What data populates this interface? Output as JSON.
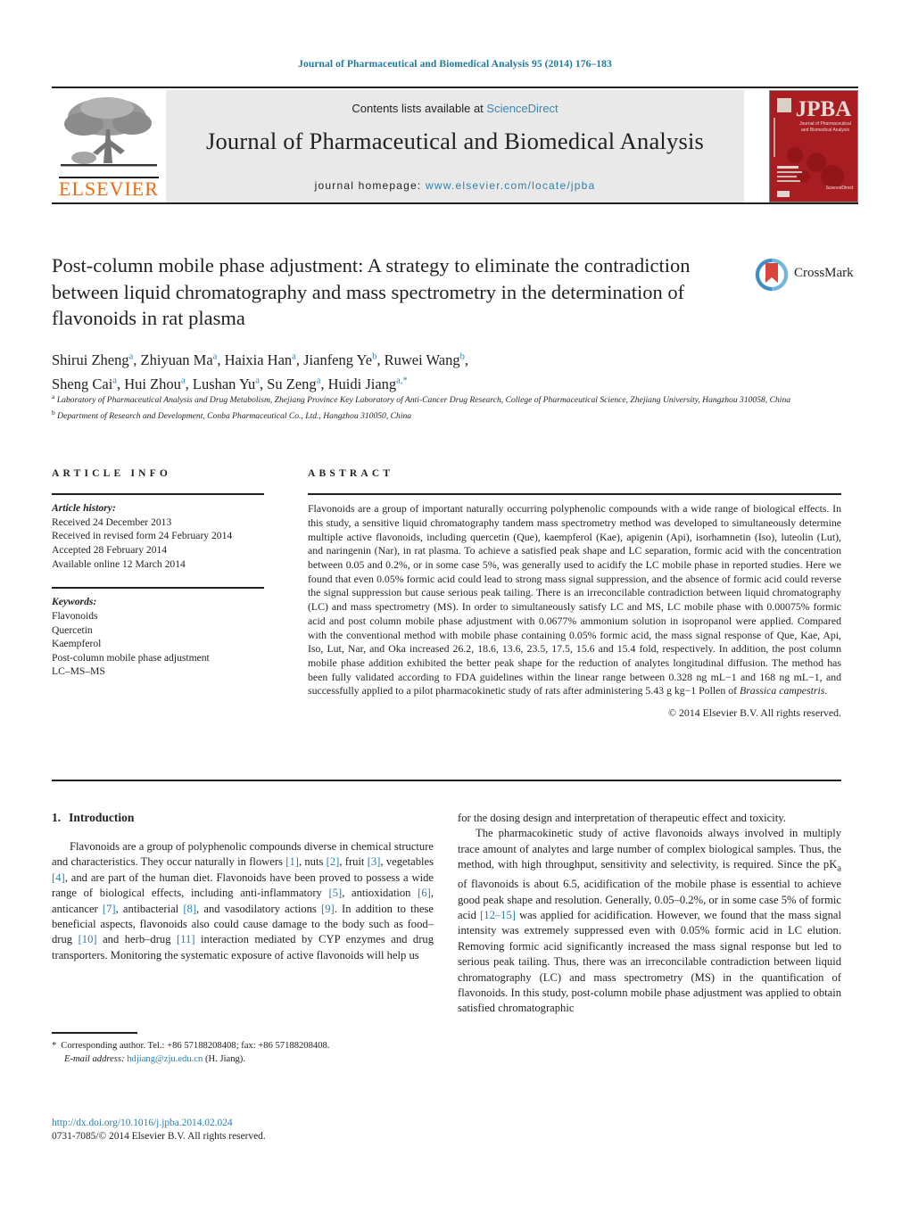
{
  "running_head": "Journal of Pharmaceutical and Biomedical Analysis 95 (2014) 176–183",
  "masthead": {
    "publisher": "ELSEVIER",
    "contents_prefix": "Contents lists available at ",
    "contents_link": "ScienceDirect",
    "journal_title": "Journal of Pharmaceutical and Biomedical Analysis",
    "homepage_label": "journal homepage:",
    "homepage_url": "www.elsevier.com/locate/jpba",
    "cover_title": "JPBA",
    "cover_subtitle": "Journal of Pharmaceutical and Biomedical Analysis",
    "cover_footer": "ScienceDirect"
  },
  "article": {
    "title": "Post-column mobile phase adjustment: A strategy to eliminate the contradiction between liquid chromatography and mass spectrometry in the determination of flavonoids in rat plasma",
    "crossmark_label": "CrossMark",
    "authors_line1": "Shirui Zheng a , Zhiyuan Ma a , Haixia Han a , Jianfeng Ye b , Ruwei Wang b ,",
    "authors_line2": "Sheng Cai a , Hui Zhou a , Lushan Yu a , Su Zeng a , Huidi Jiang a,*",
    "authors": [
      {
        "name": "Shirui Zheng",
        "sup": "a"
      },
      {
        "name": "Zhiyuan Ma",
        "sup": "a"
      },
      {
        "name": "Haixia Han",
        "sup": "a"
      },
      {
        "name": "Jianfeng Ye",
        "sup": "b"
      },
      {
        "name": "Ruwei Wang",
        "sup": "b"
      },
      {
        "name": "Sheng Cai",
        "sup": "a"
      },
      {
        "name": "Hui Zhou",
        "sup": "a"
      },
      {
        "name": "Lushan Yu",
        "sup": "a"
      },
      {
        "name": "Su Zeng",
        "sup": "a"
      },
      {
        "name": "Huidi Jiang",
        "sup": "a,*"
      }
    ],
    "affiliations": [
      {
        "marker": "a",
        "text": "Laboratory of Pharmaceutical Analysis and Drug Metabolism, Zhejiang Province Key Laboratory of Anti-Cancer Drug Research, College of Pharmaceutical Science, Zhejiang University, Hangzhou 310058, China"
      },
      {
        "marker": "b",
        "text": "Department of Research and Development, Conba Pharmaceutical Co., Ltd., Hangzhou 310050, China"
      }
    ]
  },
  "article_info": {
    "heading": "ARTICLE INFO",
    "history_label": "Article history:",
    "history": [
      "Received 24 December 2013",
      "Received in revised form 24 February 2014",
      "Accepted 28 February 2014",
      "Available online 12 March 2014"
    ],
    "keywords_label": "Keywords:",
    "keywords": [
      "Flavonoids",
      "Quercetin",
      "Kaempferol",
      "Post-column mobile phase adjustment",
      "LC–MS–MS"
    ]
  },
  "abstract": {
    "heading": "ABSTRACT",
    "text_before_italic": "Flavonoids are a group of important naturally occurring polyphenolic compounds with a wide range of biological effects. In this study, a sensitive liquid chromatography tandem mass spectrometry method was developed to simultaneously determine multiple active flavonoids, including quercetin (Que), kaempferol (Kae), apigenin (Api), isorhamnetin (Iso), luteolin (Lut), and naringenin (Nar), in rat plasma. To achieve a satisfied peak shape and LC separation, formic acid with the concentration between 0.05 and 0.2%, or in some case 5%, was generally used to acidify the LC mobile phase in reported studies. Here we found that even 0.05% formic acid could lead to strong mass signal suppression, and the absence of formic acid could reverse the signal suppression but cause serious peak tailing. There is an irreconcilable contradiction between liquid chromatography (LC) and mass spectrometry (MS). In order to simultaneously satisfy LC and MS, LC mobile phase with 0.00075% formic acid and post column mobile phase adjustment with 0.0677% ammonium solution in isopropanol were applied. Compared with the conventional method with mobile phase containing 0.05% formic acid, the mass signal response of Que, Kae, Api, Iso, Lut, Nar, and Oka increased 26.2, 18.6, 13.6, 23.5, 17.5, 15.6 and 15.4 fold, respectively. In addition, the post column mobile phase addition exhibited the better peak shape for the reduction of analytes longitudinal diffusion. The method has been fully validated according to FDA guidelines within the linear range between 0.328 ng mL−1 and 168 ng mL−1, and successfully applied to a pilot pharmacokinetic study of rats after administering 5.43 g kg−1 Pollen of ",
    "italic_species": "Brassica campestris",
    "text_after_italic": ".",
    "copyright": "© 2014 Elsevier B.V. All rights reserved."
  },
  "introduction": {
    "number": "1.",
    "heading": "Introduction",
    "left_para1_a": "Flavonoids are a group of polyphenolic compounds diverse in chemical structure and characteristics. They occur naturally in flowers ",
    "left_para1_refs": [
      "[1]",
      "[2]",
      "[3]",
      "[4]",
      "[5]",
      "[6]",
      "[7]",
      "[8]",
      "[9]",
      "[10]",
      "[11]"
    ],
    "right_ref_12_15": "[12–15]"
  },
  "footnote": {
    "star": "*",
    "corresponding": "Corresponding author. Tel.: +86 57188208408; fax: +86 57188208408.",
    "email_label": "E-mail address:",
    "email": "hdjiang@zju.edu.cn",
    "email_suffix": "(H. Jiang)."
  },
  "footer": {
    "doi": "http://dx.doi.org/10.1016/j.jpba.2014.02.024",
    "issn_line": "0731-7085/© 2014 Elsevier B.V. All rights reserved."
  }
}
